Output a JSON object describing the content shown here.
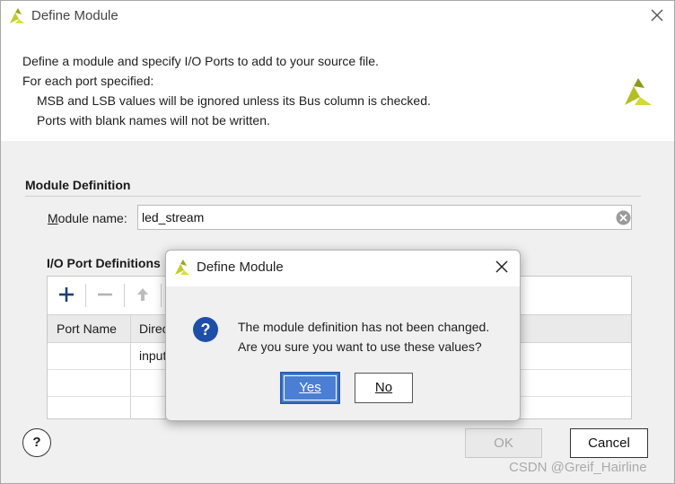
{
  "window": {
    "title": "Define Module"
  },
  "description": {
    "line1": "Define a module and specify I/O Ports to add to your source file.",
    "line2": "For each port specified:",
    "line3": "MSB and LSB values will be ignored unless its Bus column is checked.",
    "line4": "Ports with blank names will not be written."
  },
  "module_definition": {
    "section_title": "Module Definition",
    "name_label": "Module name:",
    "name_value": "led_stream"
  },
  "io_ports": {
    "section_title": "I/O Port Definitions",
    "toolbar": [
      "add-icon",
      "remove-icon",
      "move-up-icon"
    ],
    "columns": [
      "Port Name",
      "Direc"
    ],
    "rows": [
      {
        "port_name": "",
        "direction": "input"
      },
      {
        "port_name": "",
        "direction": ""
      },
      {
        "port_name": "",
        "direction": ""
      }
    ]
  },
  "buttons": {
    "help": "?",
    "ok": "OK",
    "cancel": "Cancel"
  },
  "watermark": "CSDN @Greif_Hairline",
  "dialog": {
    "title": "Define Module",
    "message_line1": "The module definition has not been changed.",
    "message_line2": "Are you sure you want to use these values?",
    "yes": "Yes",
    "no": "No",
    "icon": "question-icon"
  },
  "colors": {
    "accent": "#4a7fd4",
    "logo": "#b8c61e"
  }
}
